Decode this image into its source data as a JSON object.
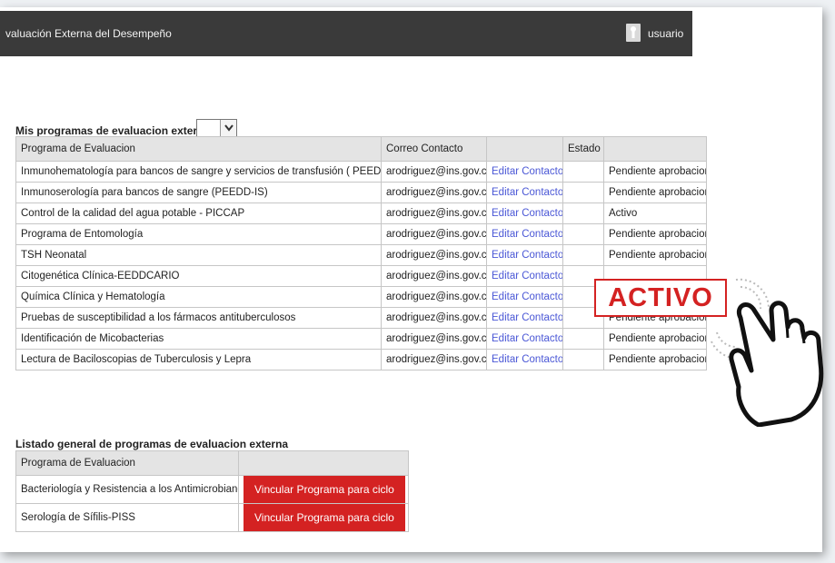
{
  "header": {
    "title": "valuación Externa del Desempeño",
    "user_label": "usuario"
  },
  "section_programs": {
    "title": "Mis programas de evaluacion externa",
    "filter_value": "",
    "columns": [
      "Programa de Evaluacion",
      "Correo Contacto",
      "",
      "Estado",
      ""
    ],
    "rows": [
      {
        "program": "Inmunohematología para bancos de sangre y servicios de transfusión ( PEEDD- IH)",
        "email": "arodriguez@ins.gov.co",
        "action": "Editar Contacto",
        "estado": "",
        "status": "Pendiente aprobacion"
      },
      {
        "program": "Inmunoserología para bancos de sangre (PEEDD-IS)",
        "email": "arodriguez@ins.gov.co",
        "action": "Editar Contacto",
        "estado": "",
        "status": "Pendiente aprobacion"
      },
      {
        "program": "Control de la calidad del agua potable - PICCAP",
        "email": "arodriguez@ins.gov.co",
        "action": "Editar Contacto",
        "estado": "",
        "status": "Activo"
      },
      {
        "program": "Programa de Entomología",
        "email": "arodriguez@ins.gov.co",
        "action": "Editar Contacto",
        "estado": "",
        "status": "Pendiente aprobacion"
      },
      {
        "program": "TSH Neonatal",
        "email": "arodriguez@ins.gov.co",
        "action": "Editar Contacto",
        "estado": "",
        "status": "Pendiente aprobacion"
      },
      {
        "program": "Citogenética Clínica-EEDDCARIO",
        "email": "arodriguez@ins.gov.co",
        "action": "Editar Contacto",
        "estado": "",
        "status": ""
      },
      {
        "program": "Química Clínica y Hematología",
        "email": "arodriguez@ins.gov.co",
        "action": "Editar Contacto",
        "estado": "",
        "status": ""
      },
      {
        "program": "Pruebas de susceptibilidad a los fármacos antituberculosos",
        "email": "arodriguez@ins.gov.co",
        "action": "Editar Contacto",
        "estado": "",
        "status": "Pendiente aprobacion"
      },
      {
        "program": "Identificación de Micobacterias",
        "email": "arodriguez@ins.gov.co",
        "action": "Editar Contacto",
        "estado": "",
        "status": "Pendiente aprobacion"
      },
      {
        "program": "Lectura de Baciloscopias de Tuberculosis y Lepra",
        "email": "arodriguez@ins.gov.co",
        "action": "Editar Contacto",
        "estado": "",
        "status": "Pendiente aprobacion"
      }
    ]
  },
  "section_general": {
    "title": "Listado general de programas de evaluacion externa",
    "columns": [
      "Programa de Evaluacion",
      ""
    ],
    "rows": [
      {
        "program": "Bacteriología y Resistencia a los Antimicrobianos",
        "button": "Vincular Programa para ciclo"
      },
      {
        "program": "Serología de Sífilis-PISS",
        "button": "Vincular Programa para ciclo"
      }
    ]
  },
  "callout": {
    "label": "ACTIVO"
  },
  "colors": {
    "header_bg": "#3a3a3a",
    "button_red": "#d42222",
    "link_blue": "#4a57d6",
    "callout_red": "#d42222"
  },
  "icons": {
    "user": "user-icon",
    "dropdown": "chevron-down-icon",
    "pointer": "pointing-hand-icon"
  }
}
